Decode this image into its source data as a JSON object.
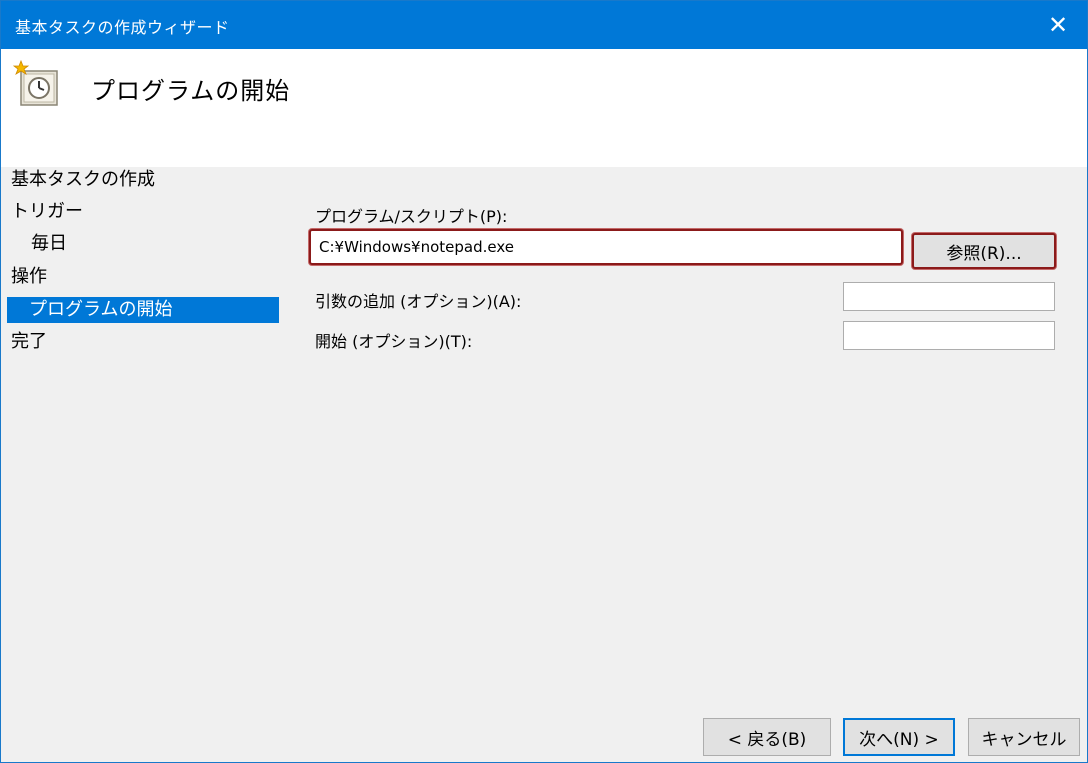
{
  "window": {
    "title": "基本タスクの作成ウィザード",
    "close_symbol": "✕"
  },
  "header": {
    "icon": "task-scheduler-clock-icon",
    "title": "プログラムの開始"
  },
  "nav": {
    "items": [
      {
        "label": "基本タスクの作成",
        "selected": false
      },
      {
        "label": "トリガー",
        "selected": false
      },
      {
        "label": "毎日",
        "selected": false
      },
      {
        "label": "操作",
        "selected": false
      },
      {
        "label": "プログラムの開始",
        "selected": true
      },
      {
        "label": "完了",
        "selected": false
      }
    ]
  },
  "form": {
    "program_label": "プログラム/スクリプト(P):",
    "program_value": "C:¥Windows¥notepad.exe",
    "browse_label": "参照(R)...",
    "args_label": "引数の追加 (オプション)(A):",
    "args_value": "",
    "start_label": "開始 (オプション)(T):",
    "start_value": ""
  },
  "footer": {
    "back_label": "< 戻る(B)",
    "next_label": "次へ(N) >",
    "cancel_label": "キャンセル"
  },
  "colors": {
    "titlebar": "#0078d7",
    "selection": "#0078d7",
    "highlight_border": "#8b1a1a"
  }
}
